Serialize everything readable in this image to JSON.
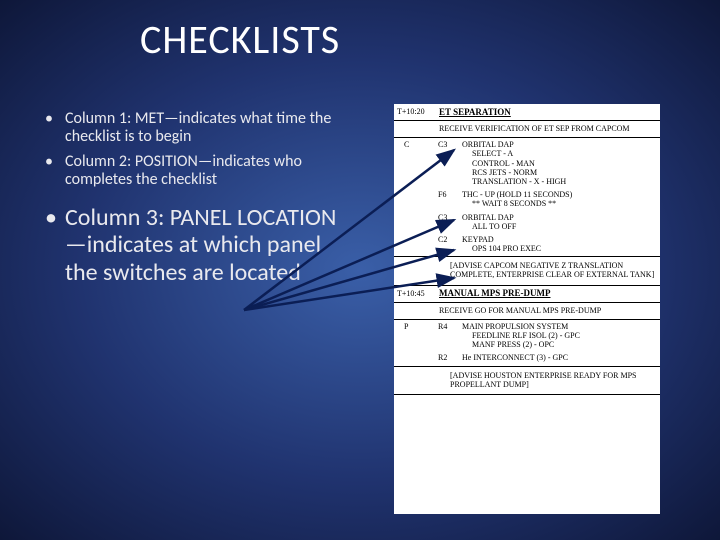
{
  "title": "CHECKLISTS",
  "bullets": {
    "b1": "Column 1: MET—indicates what time the checklist is to begin",
    "b2": "Column 2: POSITION—indicates who completes the checklist",
    "b3": "Column 3: PANEL LOCATION—indicates at which panel the switches are located"
  },
  "doc": {
    "h1_time": "T+10:20",
    "h1_title": "ET SEPARATION",
    "msg1": "RECEIVE VERIFICATION OF ET SEP FROM CAPCOM",
    "r1_c1": "C",
    "r1_c2": "C3",
    "r1_c3": "ORBITAL DAP",
    "r1_s1": "SELECT - A",
    "r1_s2": "CONTROL - MAN",
    "r1_s3": "RCS JETS - NORM",
    "r1_s4": "TRANSLATION - X - HIGH",
    "r2_c2": "F6",
    "r2_c3": "THC - UP (HOLD 11 SECONDS)",
    "r2_s1": "** WAIT 8 SECONDS **",
    "r3_c2": "C3",
    "r3_c3": "ORBITAL DAP",
    "r3_s1": "ALL TO OFF",
    "r4_c2": "C2",
    "r4_c3": "KEYPAD",
    "r4_s1": "OPS 104 PRO EXEC",
    "adv1": "[ADVISE CAPCOM NEGATIVE Z TRANSLATION COMPLETE, ENTERPRISE CLEAR OF EXTERNAL TANK]",
    "h2_time": "T+10:45",
    "h2_title": "MANUAL MPS PRE-DUMP",
    "msg2": "RECEIVE GO FOR MANUAL MPS PRE-DUMP",
    "r5_c1": "P",
    "r5_c2": "R4",
    "r5_c3": "MAIN PROPULSION SYSTEM",
    "r5_s1": "FEEDLINE RLF ISOL (2) - GPC",
    "r5_s2": "MANF PRESS (2) - OPC",
    "r6_c2": "R2",
    "r6_c3": "He INTERCONNECT (3) - GPC",
    "adv2": "[ADVISE HOUSTON ENTERPRISE READY FOR MPS PROPELLANT DUMP]"
  }
}
